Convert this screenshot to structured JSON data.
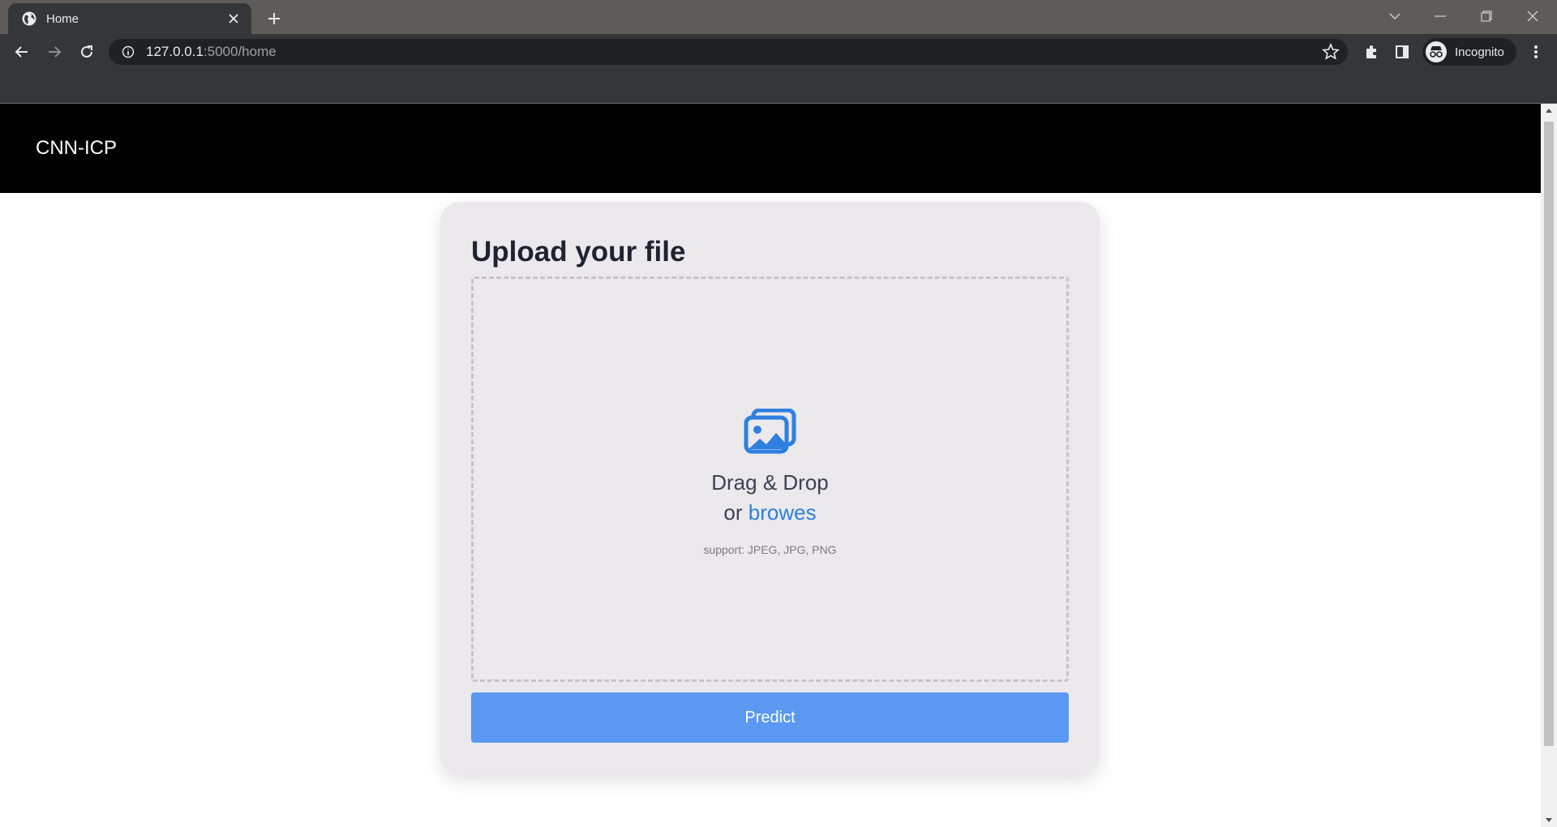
{
  "browser": {
    "tab": {
      "title": "Home",
      "icon": "globe-icon"
    },
    "url": {
      "host": "127.0.0.1",
      "path": ":5000/home"
    },
    "profile": {
      "label": "Incognito"
    }
  },
  "page": {
    "navbar": {
      "brand": "CNN-ICP"
    },
    "upload": {
      "title": "Upload your file",
      "drag_text": "Drag & Drop",
      "or_text": "or",
      "browse_text": "browes",
      "support_text": "support: JPEG, JPG, PNG",
      "icon": "images-icon",
      "predict_label": "Predict"
    }
  },
  "colors": {
    "navbar_bg": "#000000",
    "card_bg": "#ebe9eb",
    "accent": "#2e7fe0",
    "button_bg": "#5a98f2"
  }
}
